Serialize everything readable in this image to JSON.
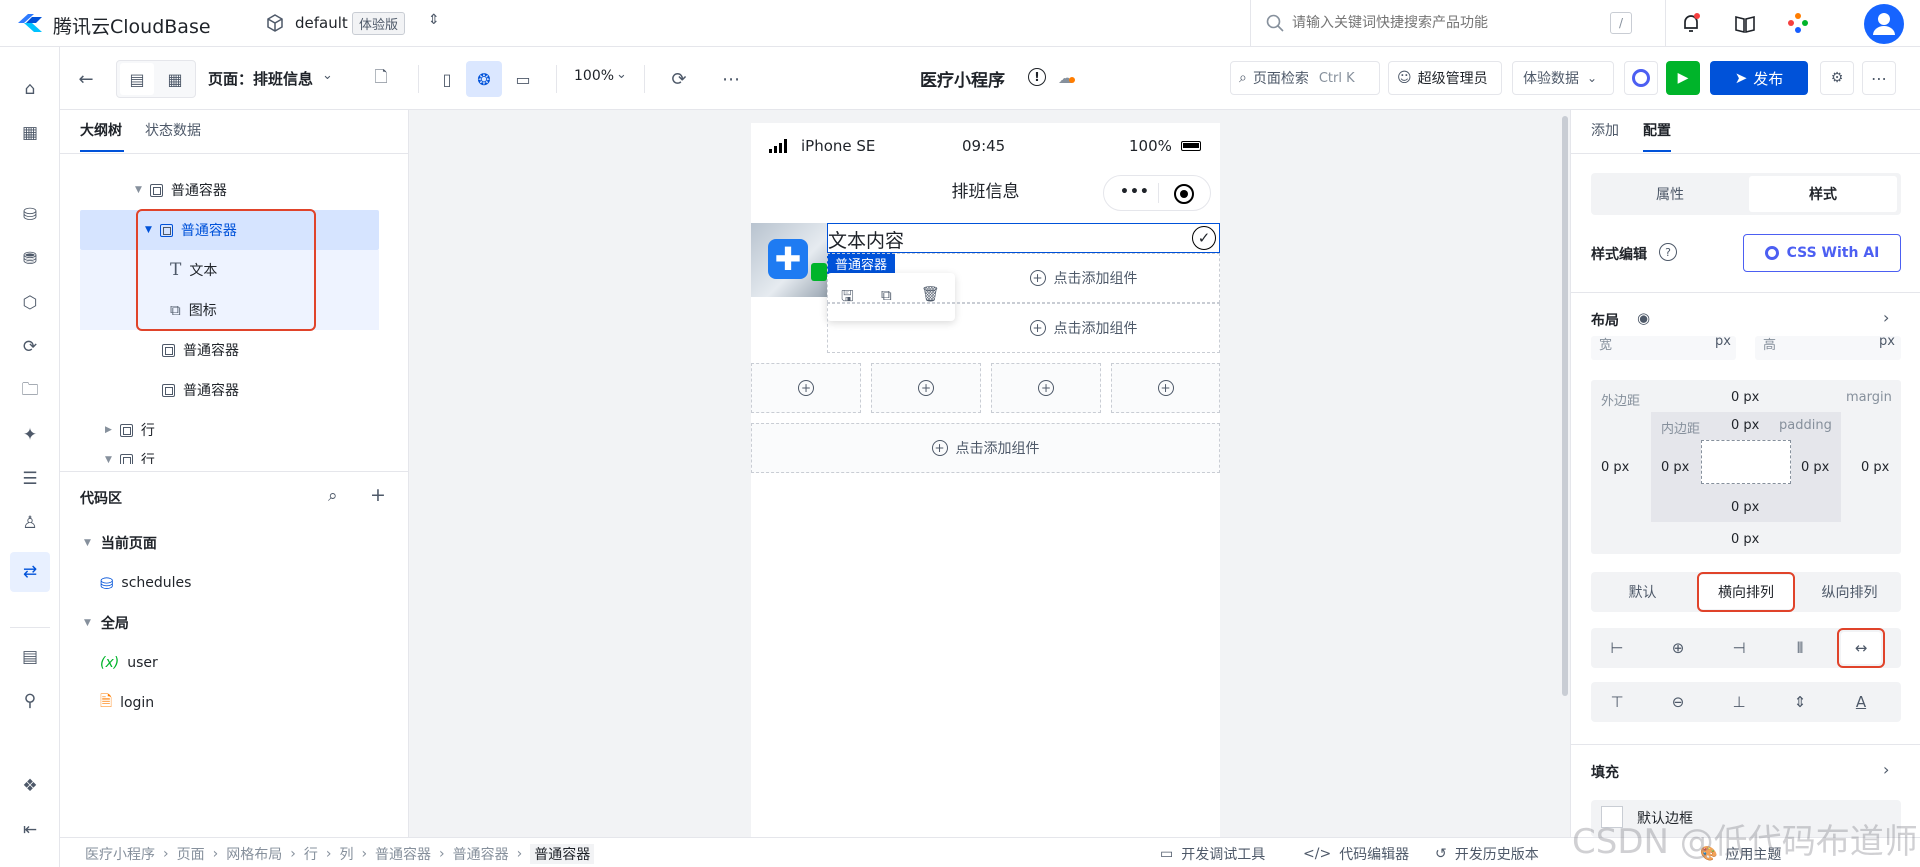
{
  "brand": {
    "name": "腾讯云CloudBase"
  },
  "env": {
    "name": "default",
    "badge": "体验版"
  },
  "global_search": {
    "placeholder": "请输入关键词快捷搜索产品功能",
    "shortcut": "/"
  },
  "toolbar": {
    "page_label": "页面：排班信息",
    "zoom": "100%",
    "app_title": "医疗小程序",
    "page_search": "页面检索",
    "page_search_shortcut": "Ctrl K",
    "role": "超级管理员",
    "data_mode": "体验数据",
    "publish": "发布"
  },
  "outline": {
    "tabs": [
      "大纲树",
      "状态数据"
    ],
    "tree": [
      {
        "label": "普通容器"
      },
      {
        "label": "普通容器"
      },
      {
        "label": "文本"
      },
      {
        "label": "图标"
      },
      {
        "label": "普通容器"
      },
      {
        "label": "普通容器"
      },
      {
        "label": "行"
      },
      {
        "label": "行"
      }
    ]
  },
  "code": {
    "title": "代码区",
    "current_page": "当前页面",
    "current_items": [
      "schedules"
    ],
    "global": "全局",
    "global_items": [
      "user",
      "login"
    ]
  },
  "phone": {
    "carrier": "iPhone SE",
    "time": "09:45",
    "battery": "100%",
    "nav_title": "排班信息",
    "text_content": "文本内容",
    "selected_tag": "普通容器",
    "add_component": "点击添加组件"
  },
  "right": {
    "tabs": [
      "添加",
      "配置"
    ],
    "mode_tabs": [
      "属性",
      "样式"
    ],
    "style_edit": "样式编辑",
    "css_ai": "CSS With AI",
    "layout": "布局",
    "width_label": "宽",
    "height_label": "高",
    "unit": "px",
    "margin_label": "外边距",
    "margin_en": "margin",
    "padding_label": "内边距",
    "padding_en": "padding",
    "zero_px": "0 px",
    "direction": [
      "默认",
      "横向排列",
      "纵向排列"
    ],
    "fill": "填充",
    "default_border": "默认边框",
    "apply_theme": "应用主题"
  },
  "breadcrumb": [
    "医疗小程序",
    "页面",
    "网格布局",
    "行",
    "列",
    "普通容器",
    "普通容器",
    "普通容器"
  ],
  "bottom_tools": [
    "开发调试工具",
    "代码编辑器",
    "开发历史版本"
  ],
  "watermark": "CSDN @低代码布道师",
  "colors": {
    "accent": "#0052d9",
    "highlight_red": "#e0432a",
    "selected_bg": "#d6e4ff",
    "green": "#00b42a"
  }
}
